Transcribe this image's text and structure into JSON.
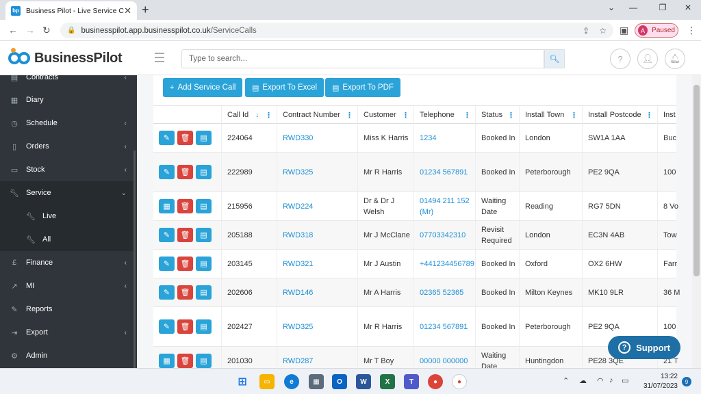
{
  "browser": {
    "tab_title": "Business Pilot - Live Service Calls",
    "favicon_text": "bp",
    "url_host": "businesspilot.app.businesspilot.co.uk",
    "url_path": "/ServiceCalls",
    "profile_initial": "A",
    "profile_status": "Paused"
  },
  "app": {
    "logo_text": "BusinessPilot",
    "search_placeholder": "Type to search..."
  },
  "sidebar": {
    "items": [
      {
        "label": "Contracts",
        "icon": "contracts-icon",
        "chevron": true
      },
      {
        "label": "Diary",
        "icon": "calendar-icon",
        "chevron": false
      },
      {
        "label": "Schedule",
        "icon": "clock-icon",
        "chevron": true
      },
      {
        "label": "Orders",
        "icon": "clipboard-icon",
        "chevron": true
      },
      {
        "label": "Stock",
        "icon": "box-icon",
        "chevron": true
      },
      {
        "label": "Service",
        "icon": "wrench-icon",
        "chevron": true,
        "expanded": true
      },
      {
        "label": "Live",
        "icon": "wrench-icon",
        "sub": true
      },
      {
        "label": "All",
        "icon": "wrench-icon",
        "sub": true
      },
      {
        "label": "Finance",
        "icon": "pound-icon",
        "chevron": true
      },
      {
        "label": "MI",
        "icon": "chart-icon",
        "chevron": true
      },
      {
        "label": "Reports",
        "icon": "pencil-icon",
        "chevron": false
      },
      {
        "label": "Export",
        "icon": "export-icon",
        "chevron": true
      },
      {
        "label": "Admin",
        "icon": "gear-icon",
        "chevron": false
      }
    ]
  },
  "toolbar": {
    "add_label": "Add Service Call",
    "excel_label": "Export To Excel",
    "pdf_label": "Export To PDF"
  },
  "table": {
    "columns": [
      "Call Id",
      "Contract Number",
      "Customer",
      "Telephone",
      "Status",
      "Install Town",
      "Install Postcode",
      "Inst"
    ],
    "rows": [
      {
        "call_id": "224064",
        "contract": "RWD330",
        "customer": "Miss K Harris",
        "telephone": "1234",
        "status": "Booked In",
        "town": "London",
        "postcode": "SW1A 1AA",
        "inst": "Buc",
        "first_icon": "pencil-icon"
      },
      {
        "call_id": "222989",
        "contract": "RWD325",
        "customer": "Mr R Harris",
        "telephone": "01234 567891",
        "status": "Booked In",
        "town": "Peterborough",
        "postcode": "PE2 9QA",
        "inst": "100",
        "first_icon": "pencil-icon"
      },
      {
        "call_id": "215956",
        "contract": "RWD224",
        "customer": "Dr & Dr J Welsh",
        "telephone": "01494 211 152 (Mr)",
        "status": "Waiting Date",
        "town": "Reading",
        "postcode": "RG7 5DN",
        "inst": "8 Vo",
        "first_icon": "calendar-icon"
      },
      {
        "call_id": "205188",
        "contract": "RWD318",
        "customer": "Mr J McClane",
        "telephone": "07703342310",
        "status": "Revisit Required",
        "town": "London",
        "postcode": "EC3N 4AB",
        "inst": "Tow",
        "first_icon": "pencil-icon"
      },
      {
        "call_id": "203145",
        "contract": "RWD321",
        "customer": "Mr J Austin",
        "telephone": "+441234456789",
        "status": "Booked In",
        "town": "Oxford",
        "postcode": "OX2 6HW",
        "inst": "Farr",
        "first_icon": "pencil-icon"
      },
      {
        "call_id": "202606",
        "contract": "RWD146",
        "customer": "Mr A Harris",
        "telephone": "02365 52365",
        "status": "Booked In",
        "town": "Milton Keynes",
        "postcode": "MK10 9LR",
        "inst": "36 M",
        "first_icon": "pencil-icon"
      },
      {
        "call_id": "202427",
        "contract": "RWD325",
        "customer": "Mr R Harris",
        "telephone": "01234 567891",
        "status": "Booked In",
        "town": "Peterborough",
        "postcode": "PE2 9QA",
        "inst": "100",
        "first_icon": "pencil-icon"
      },
      {
        "call_id": "201030",
        "contract": "RWD287",
        "customer": "Mr T Boy",
        "telephone": "00000 000000",
        "status": "Waiting Date",
        "town": "Huntingdon",
        "postcode": "PE28 3QE",
        "inst": "21 T",
        "first_icon": "calendar-icon"
      }
    ]
  },
  "support_label": "Support",
  "taskbar": {
    "time": "13:22",
    "date": "31/07/2023",
    "notifications": "9"
  }
}
